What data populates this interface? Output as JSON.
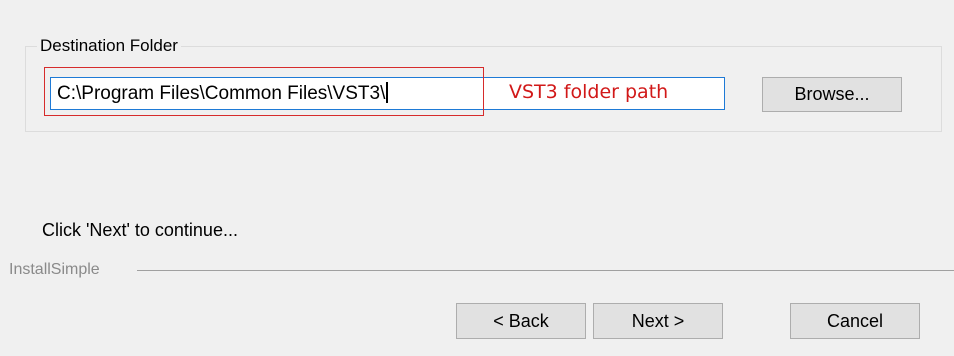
{
  "destination": {
    "group_label": "Destination Folder",
    "path_value": "C:\\Program Files\\Common Files\\VST3\\",
    "browse_label": "Browse..."
  },
  "annotation": {
    "label": "VST3 folder path",
    "color": "#d11818"
  },
  "status": {
    "text": "Click 'Next' to continue..."
  },
  "brand": {
    "label": "InstallSimple"
  },
  "navigation": {
    "back_label": "< Back",
    "next_label": "Next >",
    "cancel_label": "Cancel"
  },
  "colors": {
    "window_bg": "#f0f0f0",
    "input_focus_border": "#1e7ad6",
    "button_bg": "#e1e1e1",
    "annotation_red": "#d62b2b"
  }
}
